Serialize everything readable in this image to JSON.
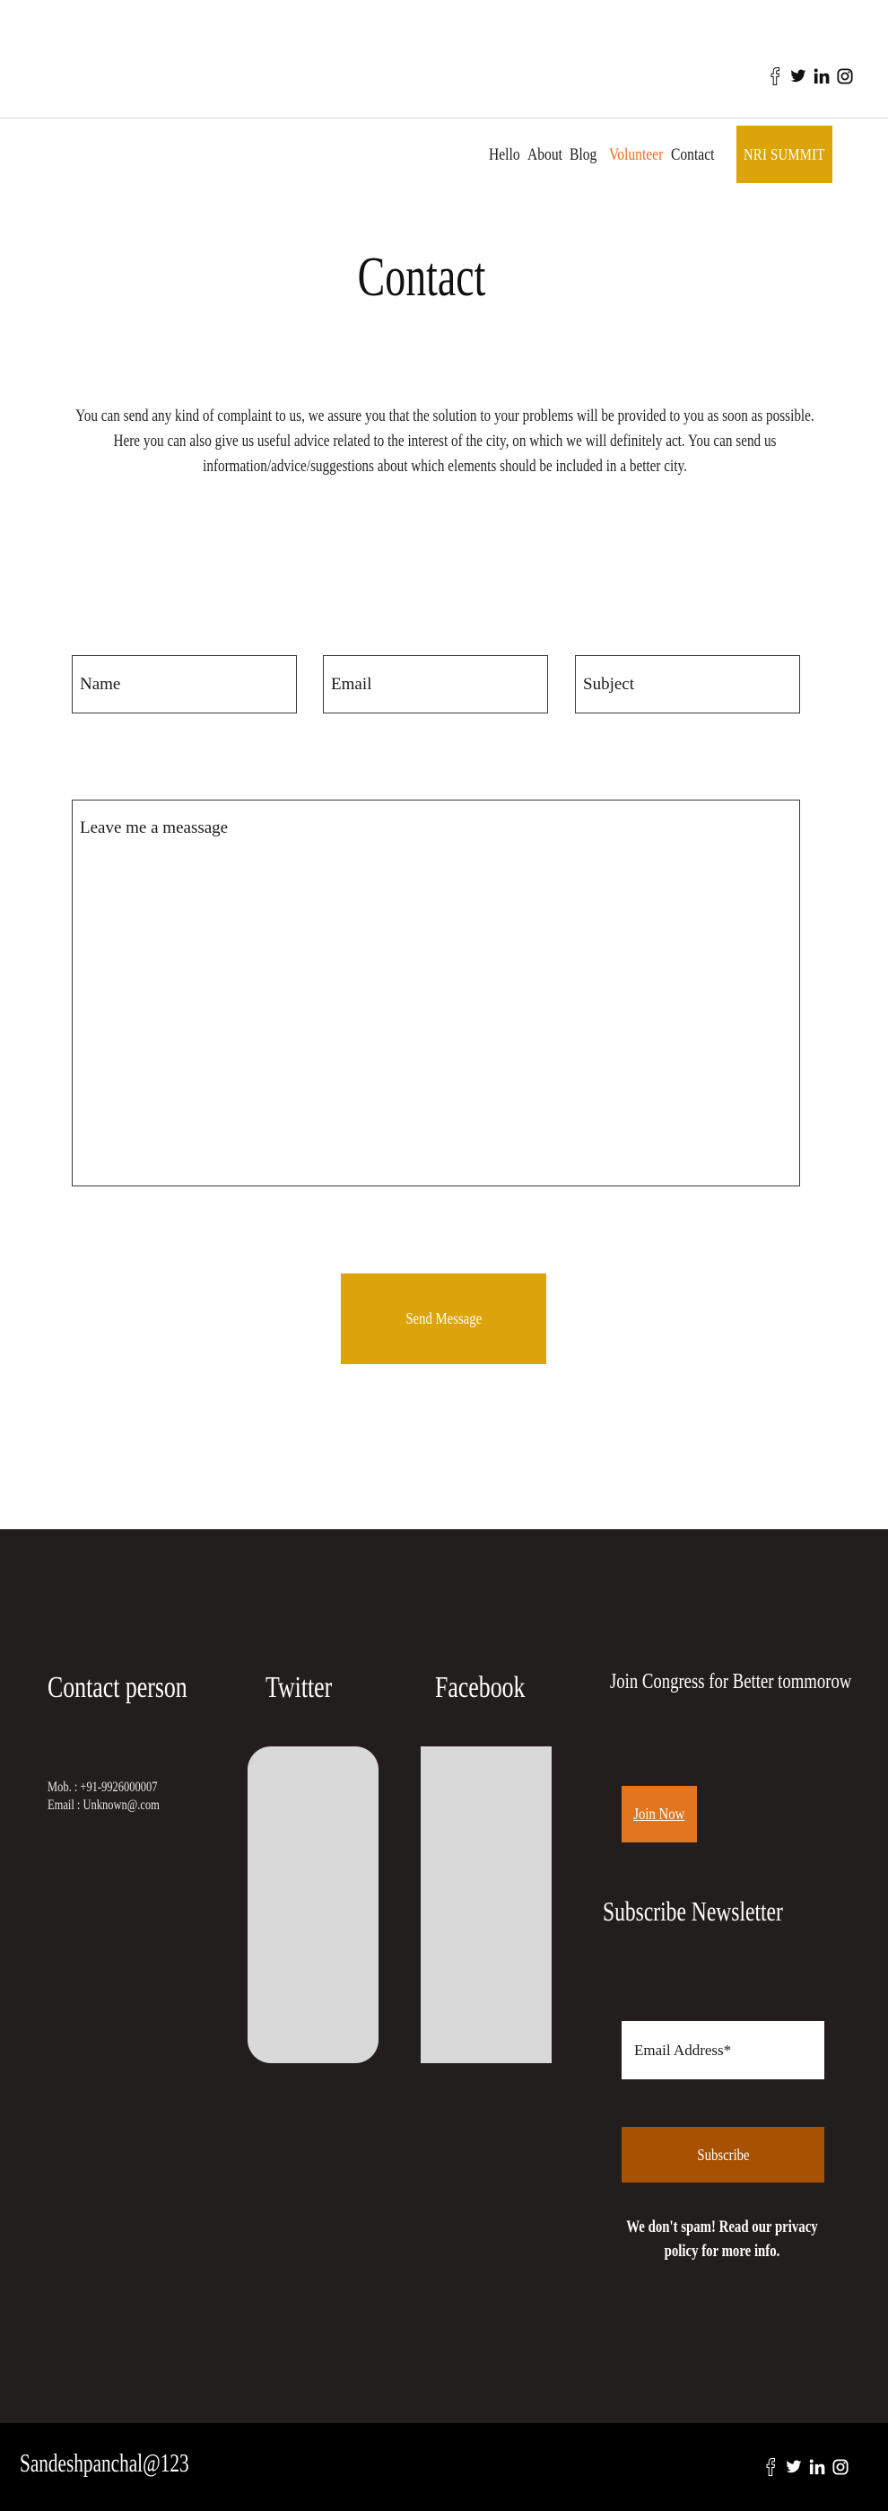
{
  "social_icons": [
    "facebook-icon",
    "twitter-icon",
    "linkedin-icon",
    "instagram-icon"
  ],
  "nav": {
    "items": [
      {
        "label": "Hello"
      },
      {
        "label": "About"
      },
      {
        "label": "Blog"
      },
      {
        "label": "Volunteer"
      },
      {
        "label": "Contact"
      }
    ],
    "cta_label": "NRI SUMMIT"
  },
  "page": {
    "title": "Contact",
    "intro": "You can send any kind of complaint to us, we assure you that the solution to your problems will be provided to you as soon as possible. Here you can also give us useful advice related to the interest of the city, on which we will definitely act.  You can send us information/advice/suggestions about which elements should be included in a better city."
  },
  "form": {
    "name_placeholder": "Name",
    "email_placeholder": "Email",
    "subject_placeholder": "Subject",
    "message_placeholder": "Leave me a meassage",
    "send_label": "Send Message"
  },
  "footer": {
    "contact_heading": "Contact person",
    "mobile": "Mob. : +91-9926000007",
    "email": "Email : Unknown@.com",
    "twitter_heading": "Twitter",
    "facebook_heading": "Facebook",
    "join_heading": "Join Congress for Better tommorow",
    "join_label": "Join Now",
    "subscribe_heading": "Subscribe Newsletter",
    "email_placeholder": "Email Address*",
    "subscribe_label": "Subscribe",
    "nospam": "We don't spam! Read our privacy policy for more info."
  },
  "bottom": {
    "text": "Sandeshpanchal@123"
  },
  "colors": {
    "accent_gold": "#dca30a",
    "nav_active": "#f06a1d",
    "join_orange": "#e1761f",
    "subscribe_brown": "#a85103",
    "footer_bg": "#221e1d",
    "bottom_bg": "#000000"
  }
}
